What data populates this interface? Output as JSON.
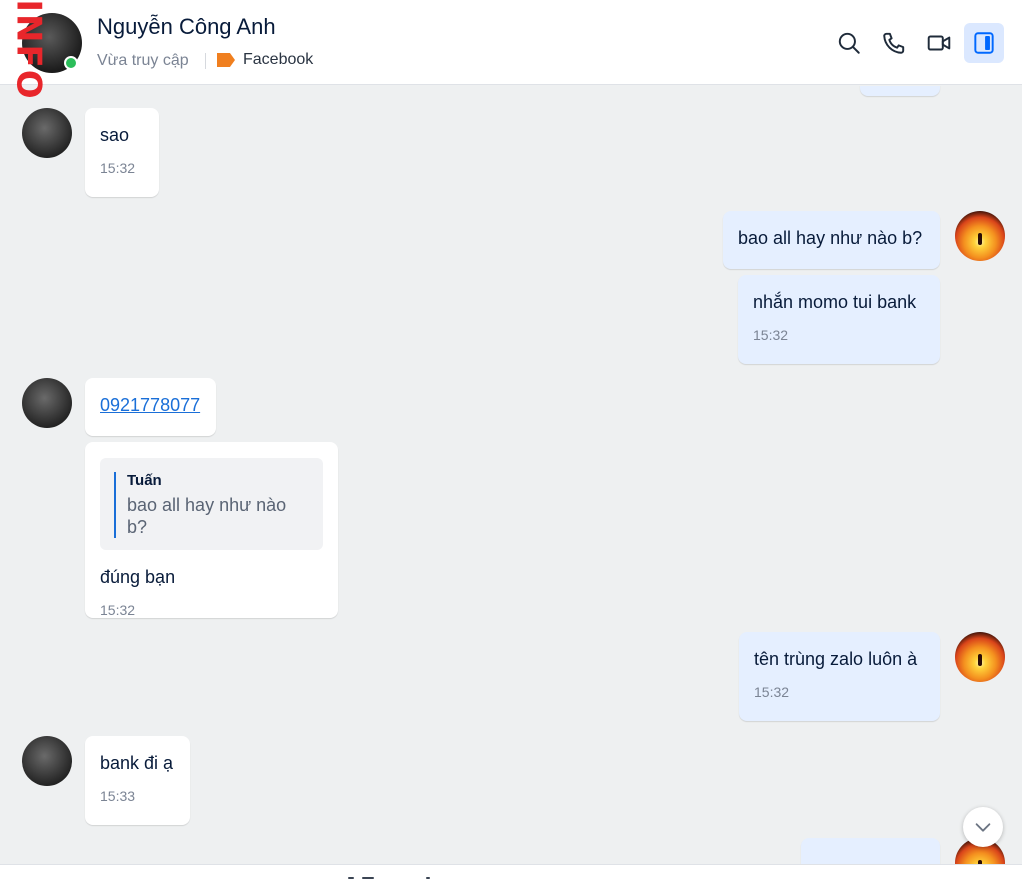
{
  "header": {
    "badge_text": "INFO",
    "contact_name": "Nguyễn Công Anh",
    "status": "Vừa truy cập",
    "tag_label": "Facebook",
    "tag_color": "#f07f1f",
    "online_color": "#2bbd5a",
    "tools": [
      "search-icon",
      "phone-icon",
      "video-call-icon",
      "sidebar-toggle-icon"
    ]
  },
  "messages": [
    {
      "from": "them",
      "text": "sao",
      "time": "15:32"
    },
    {
      "from": "me",
      "text": "bao all hay như nào b?"
    },
    {
      "from": "me",
      "text": "nhắn momo tui bank",
      "time": "15:32"
    },
    {
      "from": "them",
      "link": "0921778077"
    },
    {
      "from": "them",
      "quote_author": "Tuấn",
      "quote_text": "bao all hay như nào b?",
      "text": "đúng bạn",
      "time": "15:32"
    },
    {
      "from": "me",
      "text": "tên trùng zalo luôn à",
      "time": "15:32"
    },
    {
      "from": "them",
      "text": "bank đi ạ",
      "time": "15:33"
    }
  ],
  "colors": {
    "accent": "#0068ff",
    "outgoing_bubble": "#e5efff",
    "incoming_bubble": "#ffffff",
    "link": "#1a6fd8"
  }
}
